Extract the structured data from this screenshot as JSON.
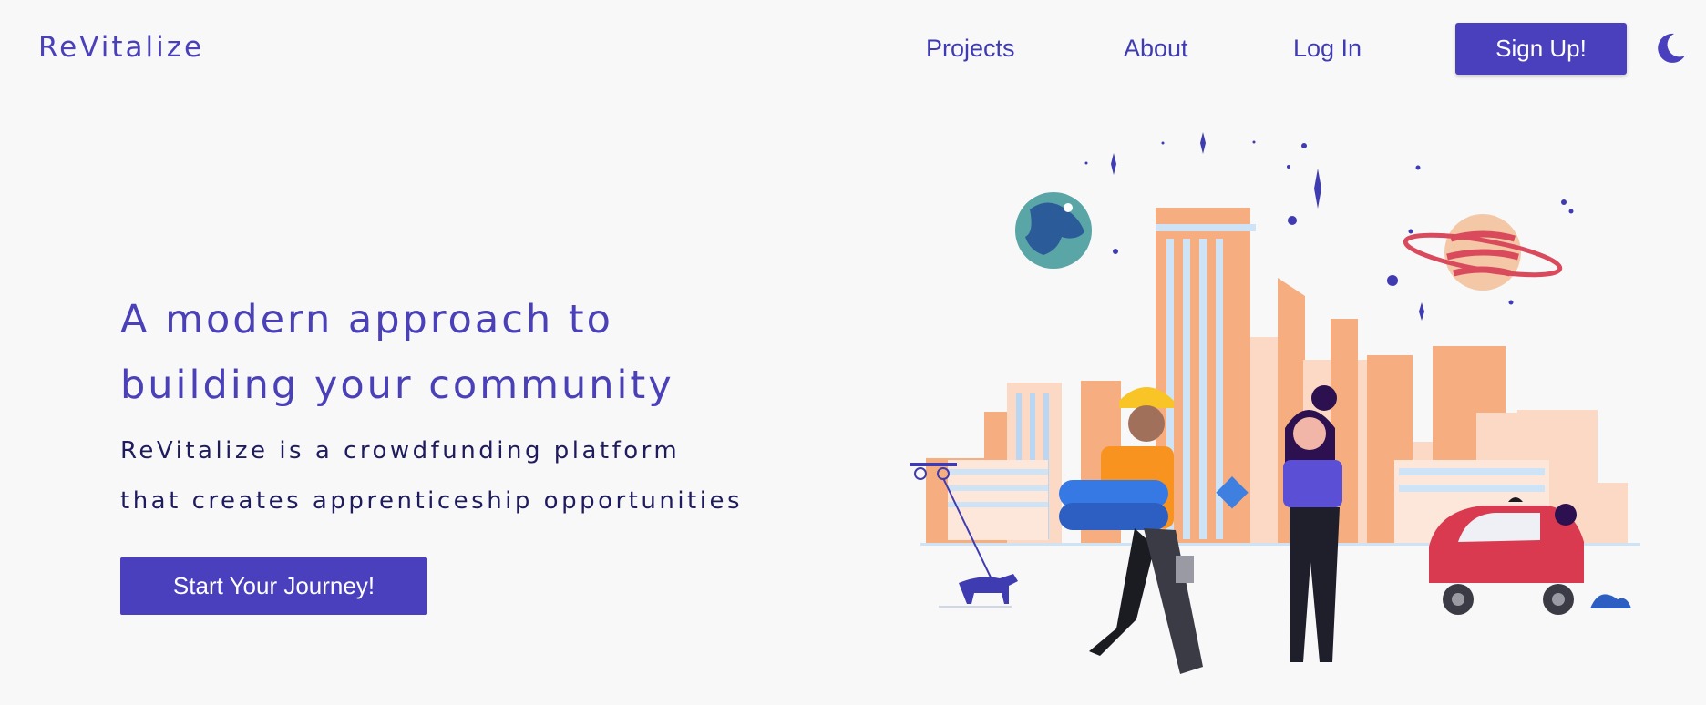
{
  "nav": {
    "brand": "ReVitalize",
    "links": [
      "Projects",
      "About",
      "Log In"
    ],
    "signup_label": "Sign Up!",
    "theme_icon": "moon-icon"
  },
  "hero": {
    "title_line1": "A modern approach to",
    "title_line2": "building your community",
    "subtitle_line1": "ReVitalize is a crowdfunding platform",
    "subtitle_line2": "that creates apprenticeship opportunities",
    "cta_label": "Start Your Journey!"
  },
  "colors": {
    "accent": "#4a3fbc",
    "background": "#f8f8f9",
    "text_dark": "#1f1c5e"
  }
}
